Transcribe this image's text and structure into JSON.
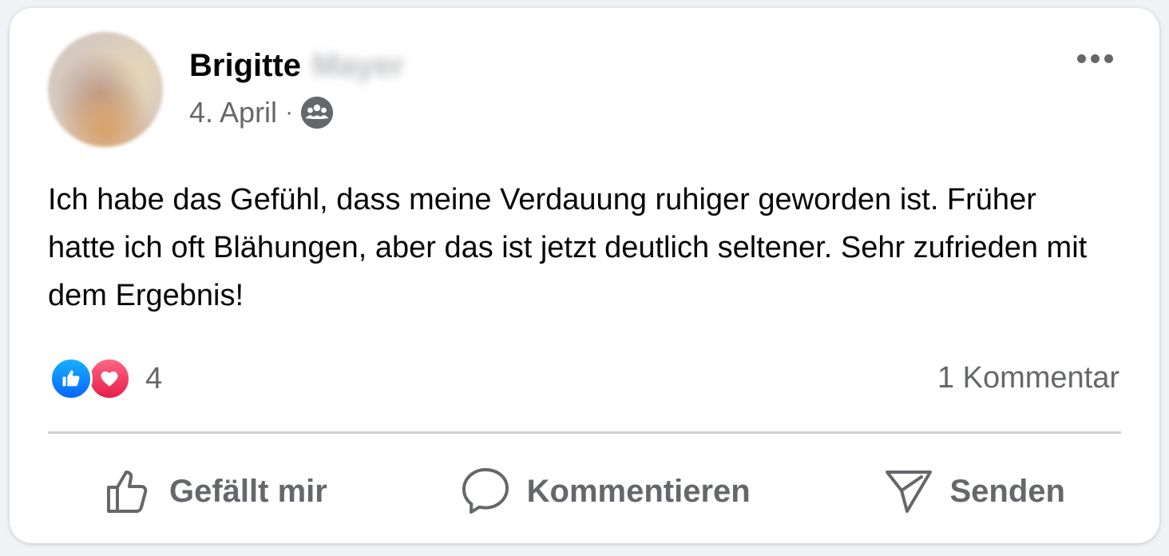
{
  "post": {
    "author_first": "Brigitte",
    "author_last": "Mayer",
    "date": "4. April",
    "separator": "·",
    "audience_icon": "group-icon",
    "more_icon": "more-options-icon",
    "text": "Ich habe das Gefühl, dass meine Verdauung ruhiger geworden ist. Früher hatte ich oft Blähungen, aber das ist jetzt deutlich seltener. Sehr zufrieden mit dem Ergebnis!"
  },
  "stats": {
    "reaction_icons": [
      "like-icon",
      "love-icon"
    ],
    "reaction_count": "4",
    "comment_count": "1 Kommentar"
  },
  "actions": {
    "like_label": "Gefällt mir",
    "comment_label": "Kommentieren",
    "share_label": "Senden"
  },
  "colors": {
    "text_primary": "#050505",
    "text_secondary": "#65676b",
    "like_blue": "#0866ff",
    "love_red": "#e61e4d",
    "divider": "#ced0d4"
  }
}
